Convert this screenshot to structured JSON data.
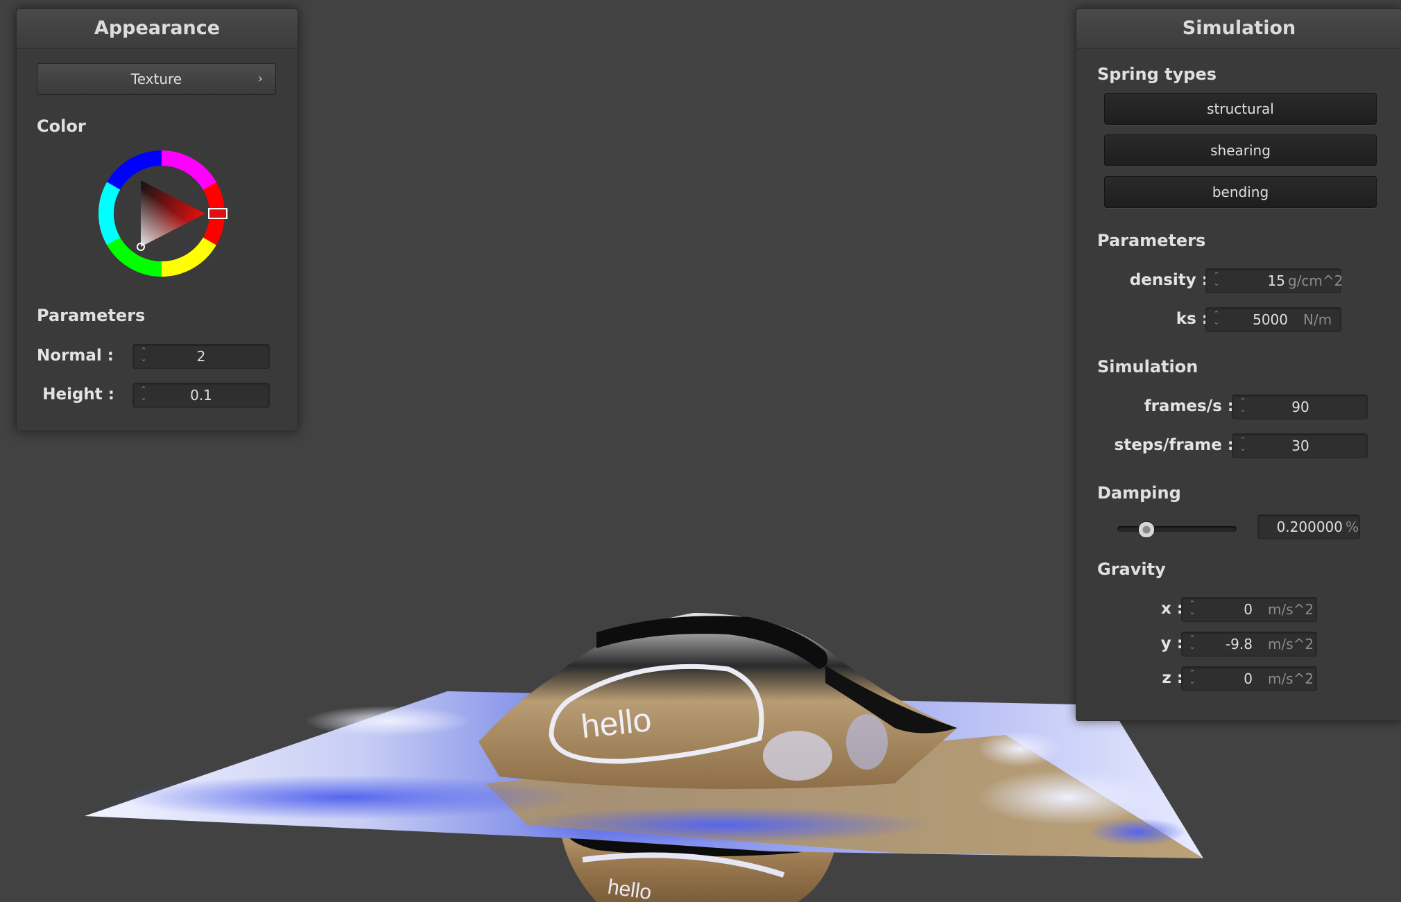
{
  "appearance": {
    "title": "Appearance",
    "texture_button": "Texture",
    "chevron": "›",
    "color_label": "Color",
    "parameters_label": "Parameters",
    "normal": {
      "label": "Normal :",
      "value": "2"
    },
    "height": {
      "label": "Height :",
      "value": "0.1"
    },
    "selected_color": "#e01010"
  },
  "simulation": {
    "title": "Simulation",
    "spring_types_label": "Spring types",
    "spring_types": [
      "structural",
      "shearing",
      "bending"
    ],
    "parameters_label": "Parameters",
    "density": {
      "label": "density :",
      "value": "15",
      "unit": "g/cm^2"
    },
    "ks": {
      "label": "ks :",
      "value": "5000",
      "unit": "N/m"
    },
    "simulation_label": "Simulation",
    "frames_per_s": {
      "label": "frames/s :",
      "value": "90"
    },
    "steps_per_frame": {
      "label": "steps/frame :",
      "value": "30"
    },
    "damping_label": "Damping",
    "damping": {
      "value": "0.200000",
      "unit": "%",
      "slider_fraction": 0.2
    },
    "gravity_label": "Gravity",
    "gravity": [
      {
        "label": "x :",
        "value": "0",
        "unit": "m/s^2"
      },
      {
        "label": "y :",
        "value": "-9.8",
        "unit": "m/s^2"
      },
      {
        "label": "z :",
        "value": "0",
        "unit": "m/s^2"
      }
    ]
  },
  "scene": {
    "sphere_text": "hello",
    "background": "#424242"
  }
}
